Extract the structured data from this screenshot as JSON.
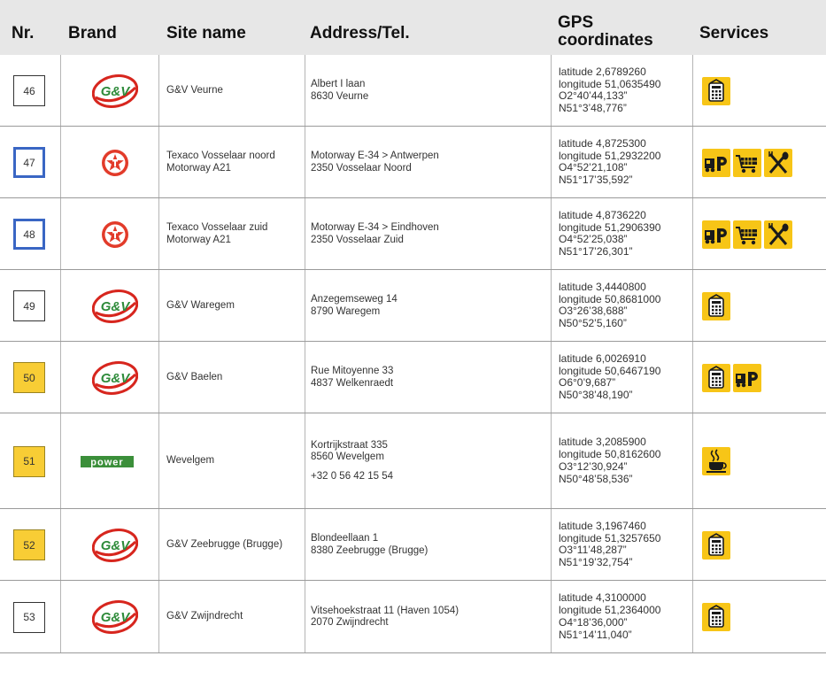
{
  "headers": {
    "nr": "Nr.",
    "brand": "Brand",
    "site": "Site name",
    "address": "Address/Tel.",
    "gps_line1": "GPS",
    "gps_line2": "coordinates",
    "services": "Services"
  },
  "colors": {
    "header_bg": "#e7e7e7",
    "accent_yellow": "#f8cd35",
    "accent_blue": "#3a66c4",
    "gv_red": "#d7261e",
    "gv_green": "#2e8b3a",
    "texaco_red": "#e23b2a",
    "power_green": "#3b8f3a"
  },
  "rows": [
    {
      "nr": "46",
      "box": "white",
      "brand": "gv-logo",
      "site": [
        "G&V Veurne"
      ],
      "address": [
        "Albert I laan",
        "8630 Veurne"
      ],
      "gps": [
        "latitude 2,6789260",
        "longitude 51,0635490",
        "O2°40’44,133”",
        "N51°3’48,776”"
      ],
      "services": [
        "shop-icon"
      ]
    },
    {
      "nr": "47",
      "box": "blue",
      "brand": "texaco-logo",
      "site": [
        "Texaco Vosselaar noord",
        "Motorway A21"
      ],
      "address": [
        "Motorway E-34 > Antwerpen",
        "2350 Vosselaar Noord"
      ],
      "gps": [
        "latitude 4,8725300",
        "longitude 51,2932200",
        "O4°52’21,108”",
        "N51°17’35,592”"
      ],
      "services": [
        "truck-parking-icon",
        "shopping-cart-icon",
        "restaurant-icon"
      ]
    },
    {
      "nr": "48",
      "box": "blue",
      "brand": "texaco-logo",
      "site": [
        "Texaco Vosselaar zuid",
        "Motorway A21"
      ],
      "address": [
        "Motorway E-34 > Eindhoven",
        "2350 Vosselaar Zuid"
      ],
      "gps": [
        "latitude 4,8736220",
        "longitude 51,2906390",
        "O4°52’25,038”",
        "N51°17’26,301”"
      ],
      "services": [
        "truck-parking-icon",
        "shopping-cart-icon",
        "restaurant-icon"
      ]
    },
    {
      "nr": "49",
      "box": "white",
      "brand": "gv-logo",
      "site": [
        "G&V Waregem"
      ],
      "address": [
        "Anzegemseweg 14",
        "8790 Waregem"
      ],
      "gps": [
        "latitude 3,4440800",
        "longitude 50,8681000",
        "O3°26’38,688”",
        "N50°52’5,160”"
      ],
      "services": [
        "shop-icon"
      ]
    },
    {
      "nr": "50",
      "box": "yellow",
      "brand": "gv-logo",
      "site": [
        "G&V Baelen"
      ],
      "address": [
        "Rue Mitoyenne 33",
        "4837 Welkenraedt"
      ],
      "gps": [
        "latitude 6,0026910",
        "longitude 50,6467190",
        "O6°0’9,687”",
        "N50°38’48,190”"
      ],
      "services": [
        "shop-icon",
        "truck-parking-icon"
      ]
    },
    {
      "nr": "51",
      "box": "yellow",
      "brand": "power-logo",
      "site": [
        "Wevelgem"
      ],
      "address": [
        "Kortrijkstraat 335",
        "8560 Wevelgem",
        "+32 0 56 42 15 54"
      ],
      "gps": [
        "latitude 3,2085900",
        "longitude 50,8162600",
        "O3°12’30,924”",
        "N50°48’58,536”"
      ],
      "services": [
        "coffee-icon"
      ]
    },
    {
      "nr": "52",
      "box": "yellow",
      "brand": "gv-logo",
      "site": [
        "G&V Zeebrugge (Brugge)"
      ],
      "address": [
        "Blondeellaan 1",
        "8380 Zeebrugge (Brugge)"
      ],
      "gps": [
        "latitude 3,1967460",
        "longitude 51,3257650",
        "O3°11’48,287”",
        "N51°19’32,754”"
      ],
      "services": [
        "shop-icon"
      ]
    },
    {
      "nr": "53",
      "box": "white",
      "brand": "gv-logo",
      "site": [
        "G&V Zwijndrecht"
      ],
      "address": [
        "Vitsehoekstraat 11 (Haven 1054)",
        "2070 Zwijndrecht"
      ],
      "gps": [
        "latitude 4,3100000",
        "longitude 51,2364000",
        "O4°18’36,000”",
        "N51°14’11,040”"
      ],
      "services": [
        "shop-icon"
      ]
    }
  ],
  "logo_text": {
    "gv": "G&V",
    "power": "power"
  }
}
